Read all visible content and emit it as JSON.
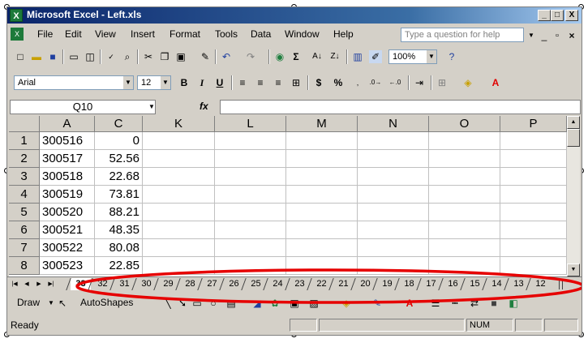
{
  "window": {
    "title": "Microsoft Excel - Left.xls",
    "app_icon": "X",
    "minimize_glyph": "_",
    "maximize_glyph": "□",
    "close_glyph": "X"
  },
  "menu": {
    "items": [
      "File",
      "Edit",
      "View",
      "Insert",
      "Format",
      "Tools",
      "Data",
      "Window",
      "Help"
    ],
    "help_placeholder": "Type a question for help"
  },
  "standard_toolbar": {
    "zoom": "100%"
  },
  "formatting_toolbar": {
    "font_name": "Arial",
    "font_size": "12",
    "bold": "B",
    "italic": "I",
    "underline": "U",
    "currency": "$",
    "percent": "%"
  },
  "formula_bar": {
    "name_box": "Q10",
    "fx": "fx"
  },
  "grid": {
    "columns": [
      "A",
      "C",
      "K",
      "L",
      "M",
      "N",
      "O",
      "P"
    ],
    "rows": [
      {
        "num": "1",
        "a": "300516",
        "c": "0"
      },
      {
        "num": "2",
        "a": "300517",
        "c": "52.56"
      },
      {
        "num": "3",
        "a": "300518",
        "c": "22.68"
      },
      {
        "num": "4",
        "a": "300519",
        "c": "73.81"
      },
      {
        "num": "5",
        "a": "300520",
        "c": "88.21"
      },
      {
        "num": "6",
        "a": "300521",
        "c": "48.35"
      },
      {
        "num": "7",
        "a": "300522",
        "c": "80.08"
      },
      {
        "num": "8",
        "a": "300523",
        "c": "22.85"
      }
    ]
  },
  "sheet_tabs": [
    "33",
    "32",
    "31",
    "30",
    "29",
    "28",
    "27",
    "26",
    "25",
    "24",
    "23",
    "22",
    "21",
    "20",
    "19",
    "18",
    "17",
    "16",
    "15",
    "14",
    "13",
    "12"
  ],
  "drawing_toolbar": {
    "draw": "Draw",
    "autoshapes": "AutoShapes"
  },
  "status_bar": {
    "status": "Ready",
    "num": "NUM"
  },
  "colors": {
    "title_bar": "#0a246a",
    "annotation_ellipse": "#e60000",
    "chrome": "#d4d0c8"
  }
}
